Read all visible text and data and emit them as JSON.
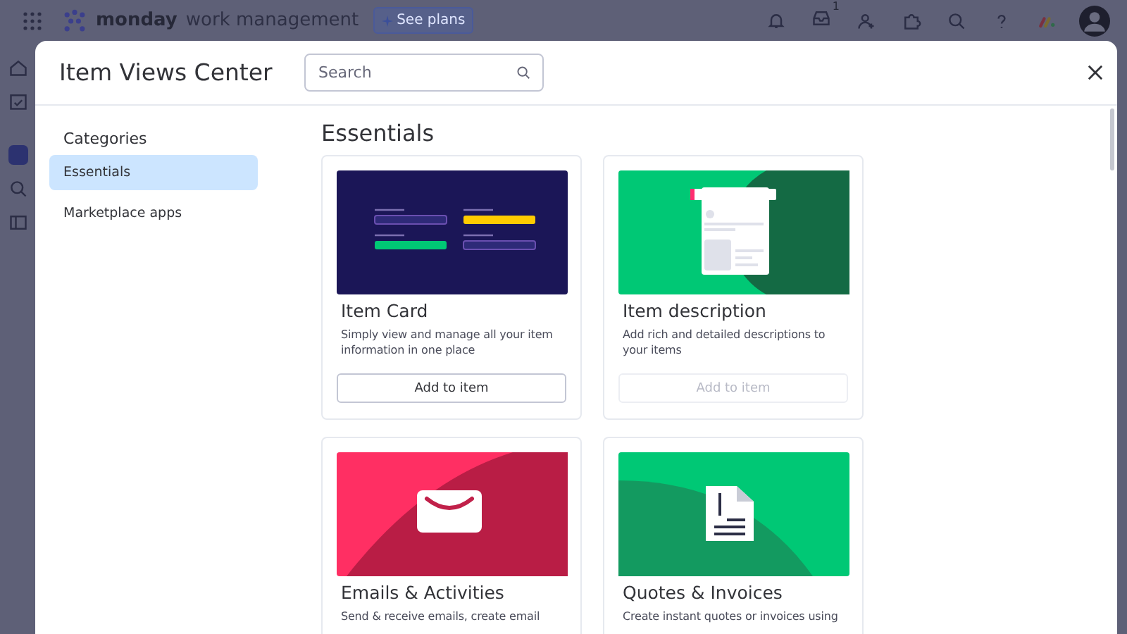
{
  "topbar": {
    "brand": "monday",
    "product": "work management",
    "plans_button": "See plans",
    "inbox_badge": "1"
  },
  "modal": {
    "title": "Item Views Center",
    "search": {
      "placeholder": "Search"
    },
    "sidebar": {
      "heading": "Categories",
      "items": [
        {
          "label": "Essentials",
          "selected": true
        },
        {
          "label": "Marketplace apps",
          "selected": false
        }
      ]
    },
    "section_title": "Essentials",
    "cards": [
      {
        "kind": "card",
        "title": "Item Card",
        "description": "Simply view and manage all your item information in one place",
        "button": "Add to item",
        "disabled": false
      },
      {
        "kind": "description",
        "title": "Item description",
        "description": "Add rich and detailed descriptions to your items",
        "button": "Add to item",
        "disabled": true
      },
      {
        "kind": "email",
        "title": "Emails & Activities",
        "description": "Send & receive emails, create email"
      },
      {
        "kind": "invoice",
        "title": "Quotes & Invoices",
        "description": "Create instant quotes or invoices using"
      }
    ]
  }
}
